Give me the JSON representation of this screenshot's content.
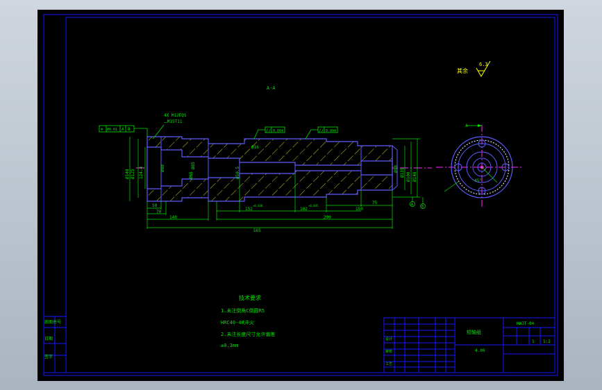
{
  "colors": {
    "background": "#000000",
    "frame": "#1818ff",
    "part": "#5b5bff",
    "dimension": "#00e600",
    "annotation": "#ffff00",
    "centerline": "#ff2aff",
    "hatch": "#ffff33"
  },
  "section_label": "A-A",
  "surface_finish": {
    "label": "其余",
    "value": "6.3"
  },
  "hole_note": {
    "line1": "4X M12EQS",
    "line2": "⌴M15T11"
  },
  "tolerance_frames": {
    "left": [
      "⊚",
      "Ø0.01",
      "A",
      "B",
      ""
    ],
    "middle": [
      "//",
      "0.004"
    ],
    "right": [
      "//",
      "0.004"
    ]
  },
  "small_dim": "Ø16",
  "diameters": [
    "Ø140",
    "Ø125",
    "124.4",
    "Ø80",
    "Ø65",
    "Ø85",
    "Ø50.5",
    "Ø90",
    "Ø135",
    "Ø100",
    "Ø148"
  ],
  "horizontal_dims": {
    "d50": "50",
    "d70": "70",
    "d140": "140",
    "d152": "152",
    "d152_tol": "+0.030",
    "d102": "102",
    "d102_tol": "+0.045",
    "d150": "150",
    "d75": "75",
    "d290": "290",
    "d565": "565"
  },
  "datum_labels": {
    "a": "A",
    "b": "B"
  },
  "end_view": {
    "label": "A",
    "angle": "45°"
  },
  "tech_requirements": {
    "title": "技术要求",
    "line1": "1.未注倒角C倒圆R5",
    "line2": "HRC40-48淬火",
    "line3": "2.未注长度尺寸允许偏差",
    "line4": "±0.3mm"
  },
  "title_block": {
    "part_name": "短轴组",
    "drawing_no": "HWJT-04",
    "scale": "1:2",
    "weight": "4.00",
    "row1": [
      "设计",
      "",
      "",
      ""
    ],
    "row2": [
      "审核",
      "",
      "",
      ""
    ],
    "row3": [
      "工艺",
      "",
      "",
      ""
    ],
    "cell_a": "1",
    "cell_b": "1:2"
  },
  "side_labels": [
    "底图总号",
    "日期",
    "签字"
  ]
}
